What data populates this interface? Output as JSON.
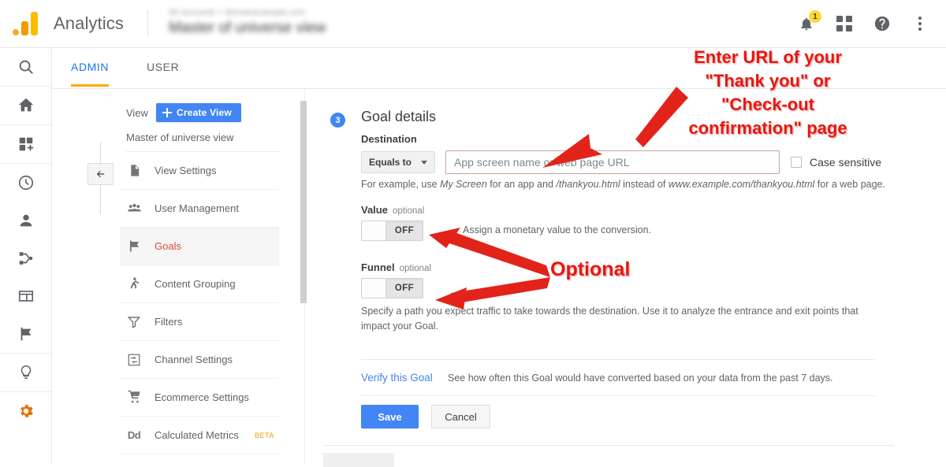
{
  "header": {
    "brand": "Analytics",
    "account_line1": "All accounts > domainexample.com",
    "account_line2": "Master of universe view",
    "notification_count": "1",
    "icons": [
      "bell-icon",
      "apps-grid-icon",
      "help-icon",
      "overflow-menu-icon"
    ]
  },
  "rail": {
    "items": [
      {
        "name": "search",
        "icon": "search-icon"
      },
      {
        "name": "home",
        "icon": "home-icon"
      },
      {
        "name": "customization",
        "icon": "dashboard-add-icon"
      },
      {
        "name": "realtime",
        "icon": "clock-icon"
      },
      {
        "name": "audience",
        "icon": "person-icon"
      },
      {
        "name": "acquisition",
        "icon": "share-nodes-icon"
      },
      {
        "name": "behavior",
        "icon": "page-layout-icon"
      },
      {
        "name": "conversions",
        "icon": "flag-icon"
      },
      {
        "name": "discover",
        "icon": "lightbulb-icon"
      },
      {
        "name": "admin",
        "icon": "gear-icon",
        "active": true
      }
    ]
  },
  "tabs": {
    "admin": "ADMIN",
    "user": "USER"
  },
  "view_column": {
    "label": "View",
    "create_button": "Create View",
    "view_name": "Master of universe view",
    "items": [
      {
        "label": "View Settings",
        "icon": "document-icon"
      },
      {
        "label": "User Management",
        "icon": "people-icon"
      },
      {
        "label": "Goals",
        "icon": "flag-icon",
        "selected": true
      },
      {
        "label": "Content Grouping",
        "icon": "person-walking-icon"
      },
      {
        "label": "Filters",
        "icon": "funnel-icon"
      },
      {
        "label": "Channel Settings",
        "icon": "channel-arrows-icon"
      },
      {
        "label": "Ecommerce Settings",
        "icon": "shopping-cart-icon"
      },
      {
        "label": "Calculated Metrics",
        "icon": "dd-icon",
        "badge": "BETA"
      }
    ]
  },
  "form": {
    "step_number": "3",
    "title": "Goal details",
    "destination_label": "Destination",
    "match_type": "Equals to",
    "url_placeholder": "App screen name or web page URL",
    "url_value": "",
    "case_sensitive_label": "Case sensitive",
    "example_prefix": "For example, use ",
    "example_screen": "My Screen",
    "example_mid": " for an app and ",
    "example_path": "/thankyou.html",
    "example_mid2": " instead of ",
    "example_url": "www.example.com/thankyou.html",
    "example_suffix": " for a web page.",
    "value_label": "Value",
    "value_optional": "optional",
    "value_toggle_state": "OFF",
    "value_help": "Assign a monetary value to the conversion.",
    "funnel_label": "Funnel",
    "funnel_optional": "optional",
    "funnel_toggle_state": "OFF",
    "funnel_help": "Specify a path you expect traffic to take towards the destination. Use it to analyze the entrance and exit points that impact your Goal.",
    "verify_link": "Verify this Goal",
    "verify_help": "See how often this Goal would have converted based on your data from the past 7 days.",
    "save_label": "Save",
    "cancel_label": "Cancel"
  },
  "annotations": {
    "url_note_line1": "Enter URL of your",
    "url_note_line2": "\"Thank you\" or",
    "url_note_line3": "\"Check-out",
    "url_note_line4": "confirmation\" page",
    "optional_note": "Optional",
    "color": "#e8170f"
  }
}
